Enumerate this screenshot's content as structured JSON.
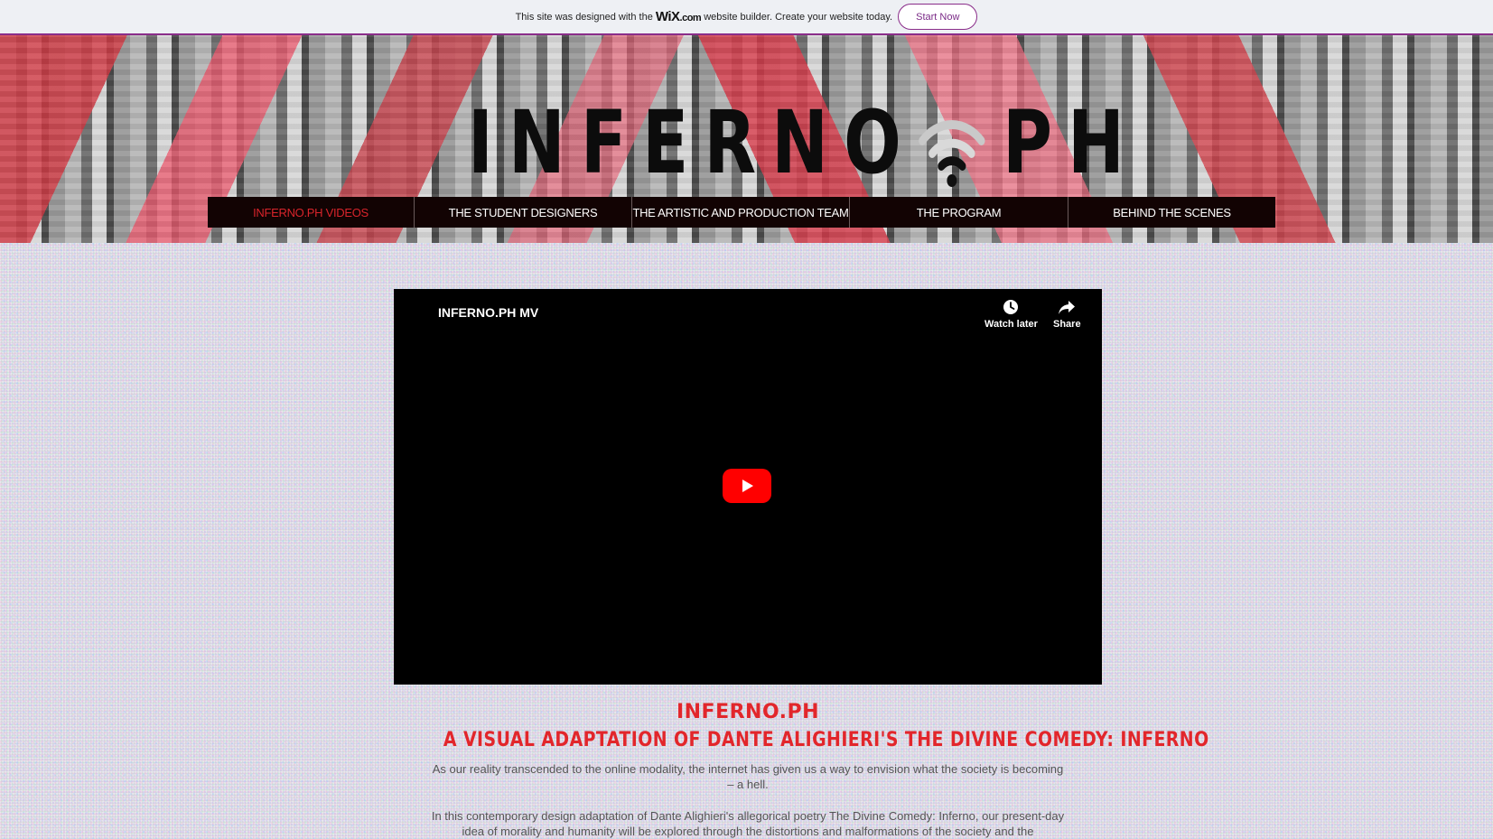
{
  "wix_banner": {
    "text_before": "This site was designed with the",
    "logo_wix": "WiX",
    "logo_domain": ".com",
    "text_after": "website builder. Create your website today.",
    "cta_label": "Start Now"
  },
  "header": {
    "logo_left": "INFERNO",
    "logo_right": "PH",
    "logo_icon": "wifi-icon"
  },
  "nav": {
    "items": [
      {
        "label": "INFERNO.PH VIDEOS",
        "active": true
      },
      {
        "label": "THE STUDENT DESIGNERS",
        "active": false
      },
      {
        "label": "THE ARTISTIC AND PRODUCTION TEAM",
        "active": false
      },
      {
        "label": "THE PROGRAM",
        "active": false
      },
      {
        "label": "BEHIND THE SCENES",
        "active": false
      }
    ]
  },
  "video": {
    "title": "INFERNO.PH MV",
    "watch_later_label": "Watch later",
    "share_label": "Share",
    "play_icon": "youtube-play-icon"
  },
  "content": {
    "heading": "INFERNO.PH",
    "subheading": "A VISUAL ADAPTATION OF DANTE ALIGHIERI'S THE DIVINE COMEDY: INFERNO",
    "paragraph_1": "As our reality transcended to the online modality, the internet has given us a way to envision what the society is becoming – a hell.",
    "paragraph_2": "In this contemporary design adaptation of Dante Alighieri's allegorical poetry The Divine Comedy: Inferno, our present-day idea of morality and humanity will be explored through the distortions and malformations of the society and the"
  },
  "colors": {
    "accent_red": "#e2262b",
    "nav_bg": "#120303",
    "wix_border": "#8a2d8a",
    "youtube_red": "#ff0000"
  }
}
